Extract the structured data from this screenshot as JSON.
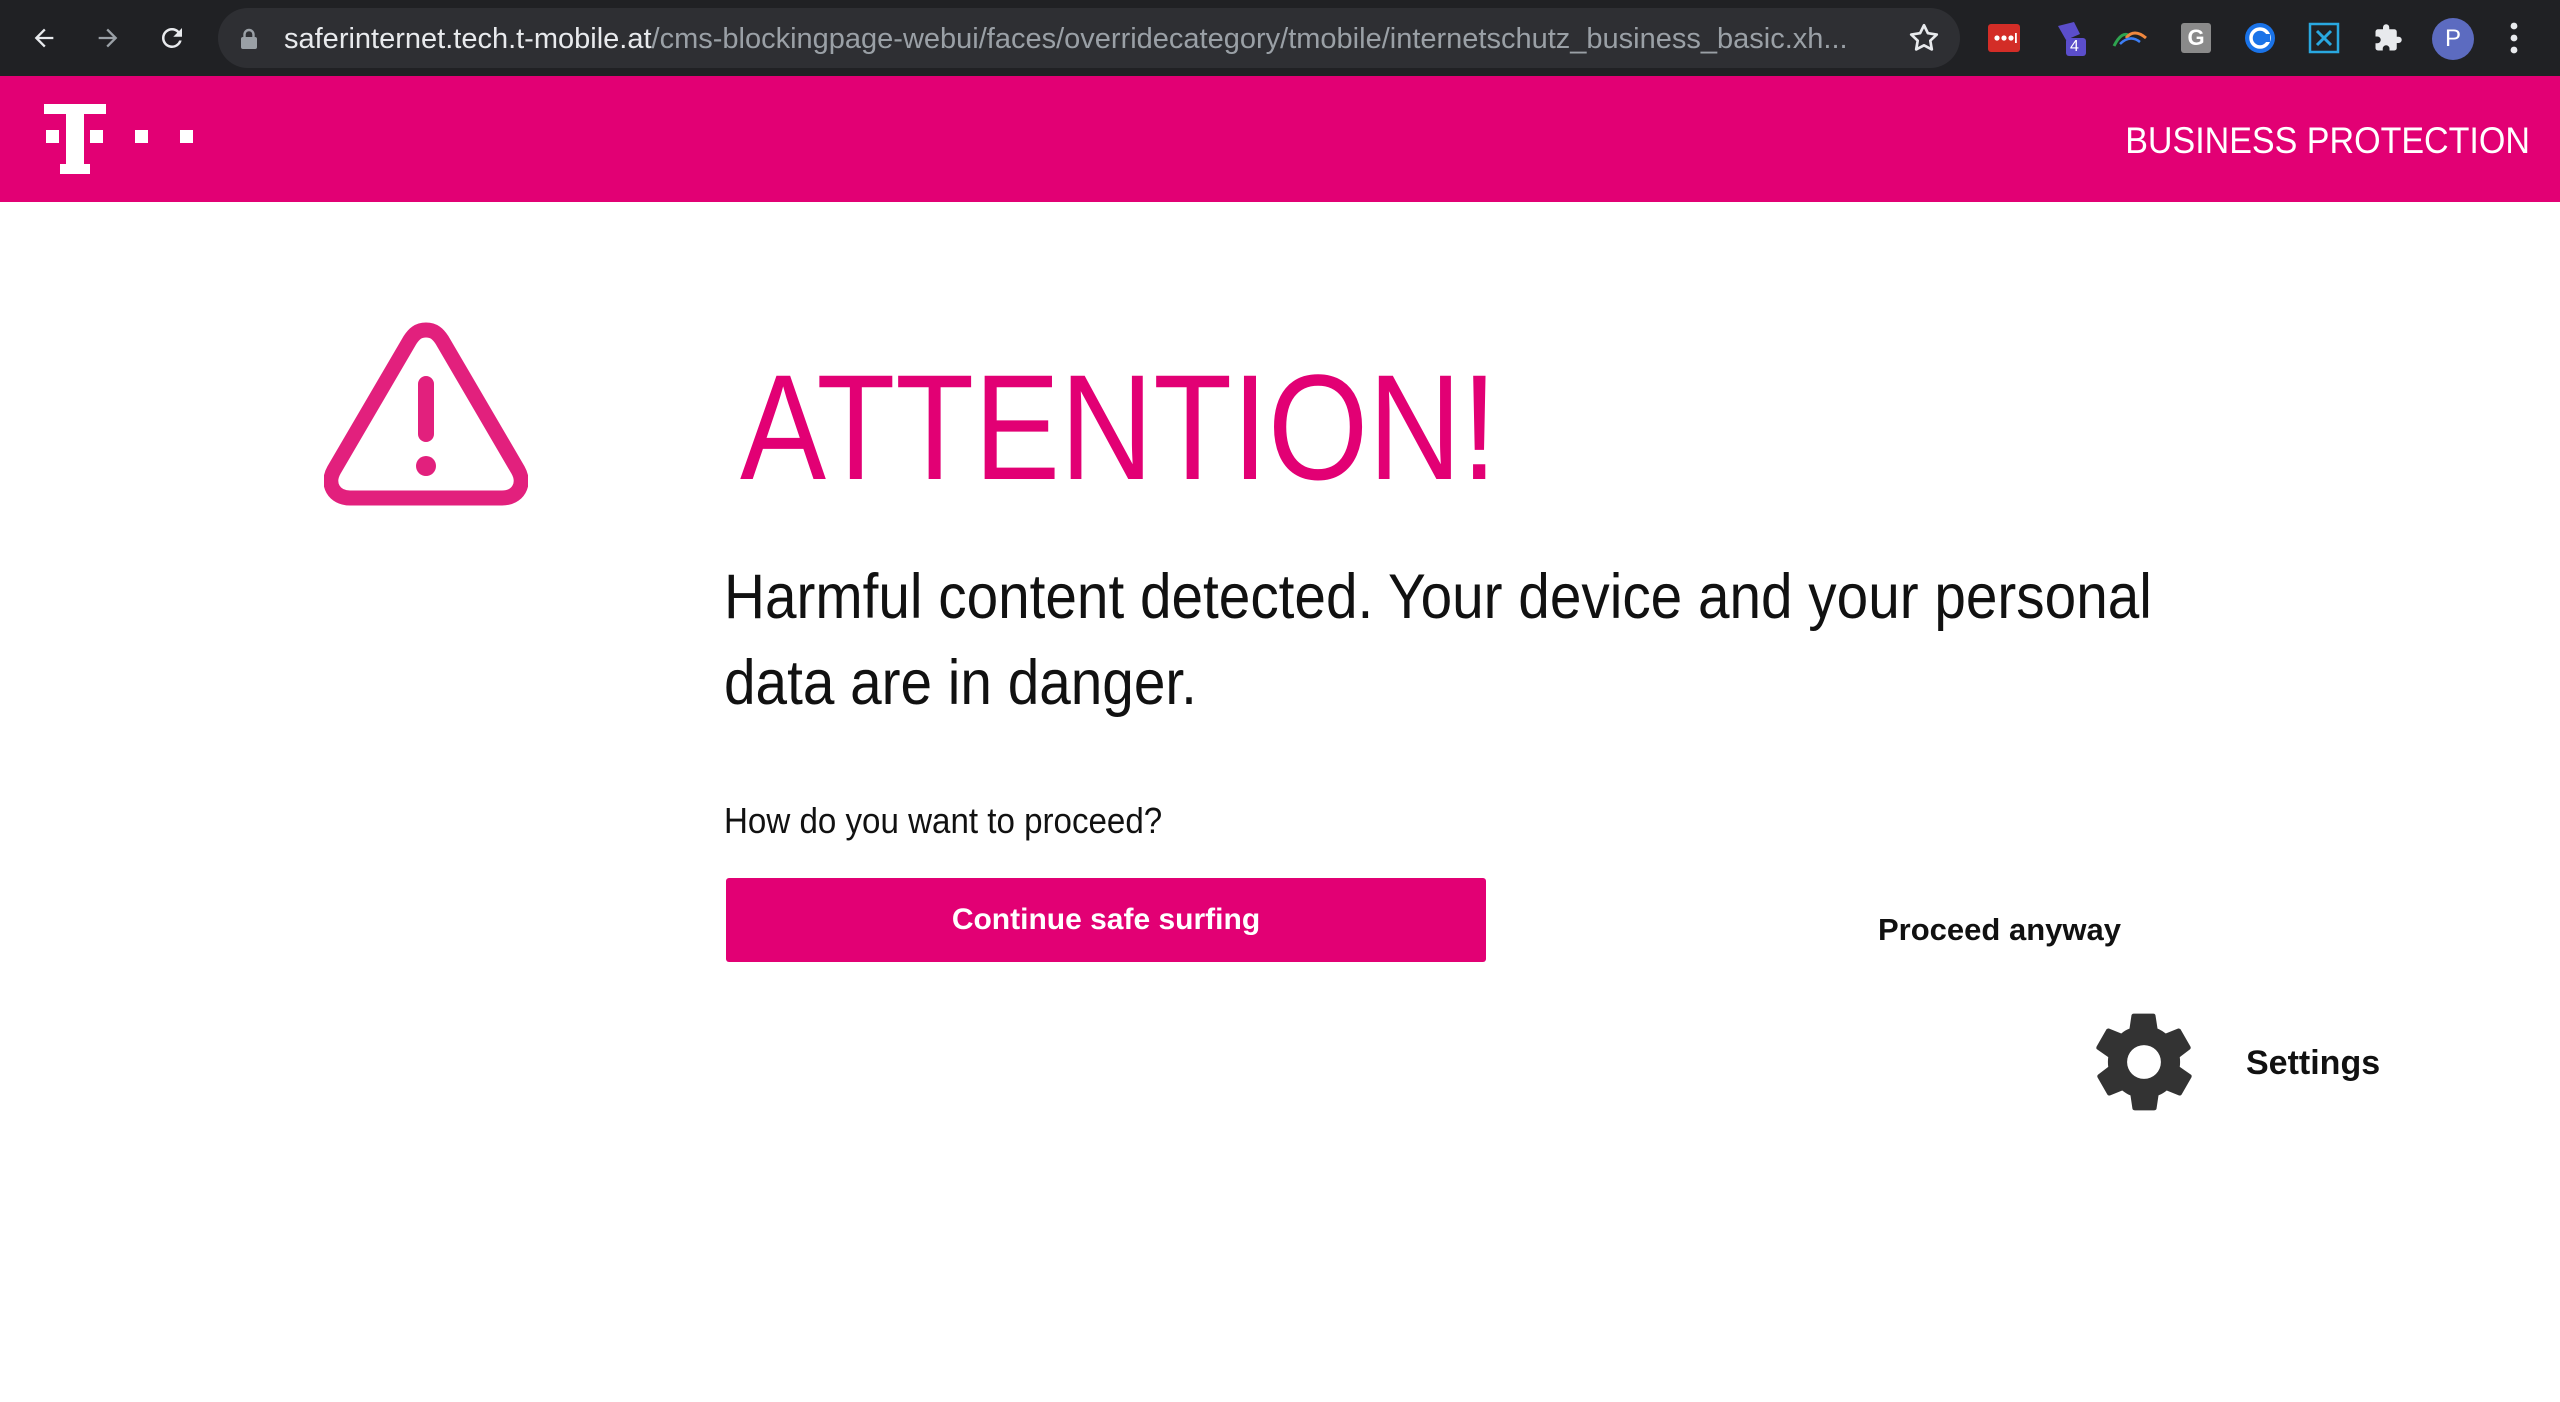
{
  "browser": {
    "url_host": "saferinternet.tech.t-mobile.at",
    "url_path": "/cms-blockingpage-webui/faces/overridecategory/tmobile/internetschutz_business_basic.xh...",
    "extension_badge_count": "4",
    "extension_letter": "G",
    "profile_initial": "P",
    "icons": [
      "back-arrow-icon",
      "forward-arrow-icon",
      "reload-icon",
      "lock-icon",
      "star-icon",
      "puzzle-icon",
      "menu-dots-icon"
    ]
  },
  "header": {
    "title": "BUSINESS PROTECTION",
    "brand_color": "#e20074"
  },
  "warning": {
    "icon": "warning-triangle-icon",
    "title": "ATTENTION!",
    "message": "Harmful content detected. Your device and your personal data are in danger.",
    "question": "How do you want to proceed?"
  },
  "actions": {
    "continue_label": "Continue safe surfing",
    "proceed_label": "Proceed anyway",
    "settings_label": "Settings",
    "settings_icon": "gear-icon"
  },
  "colors": {
    "accent": "#e20074",
    "text": "#111111",
    "chrome_bg": "#202124"
  }
}
